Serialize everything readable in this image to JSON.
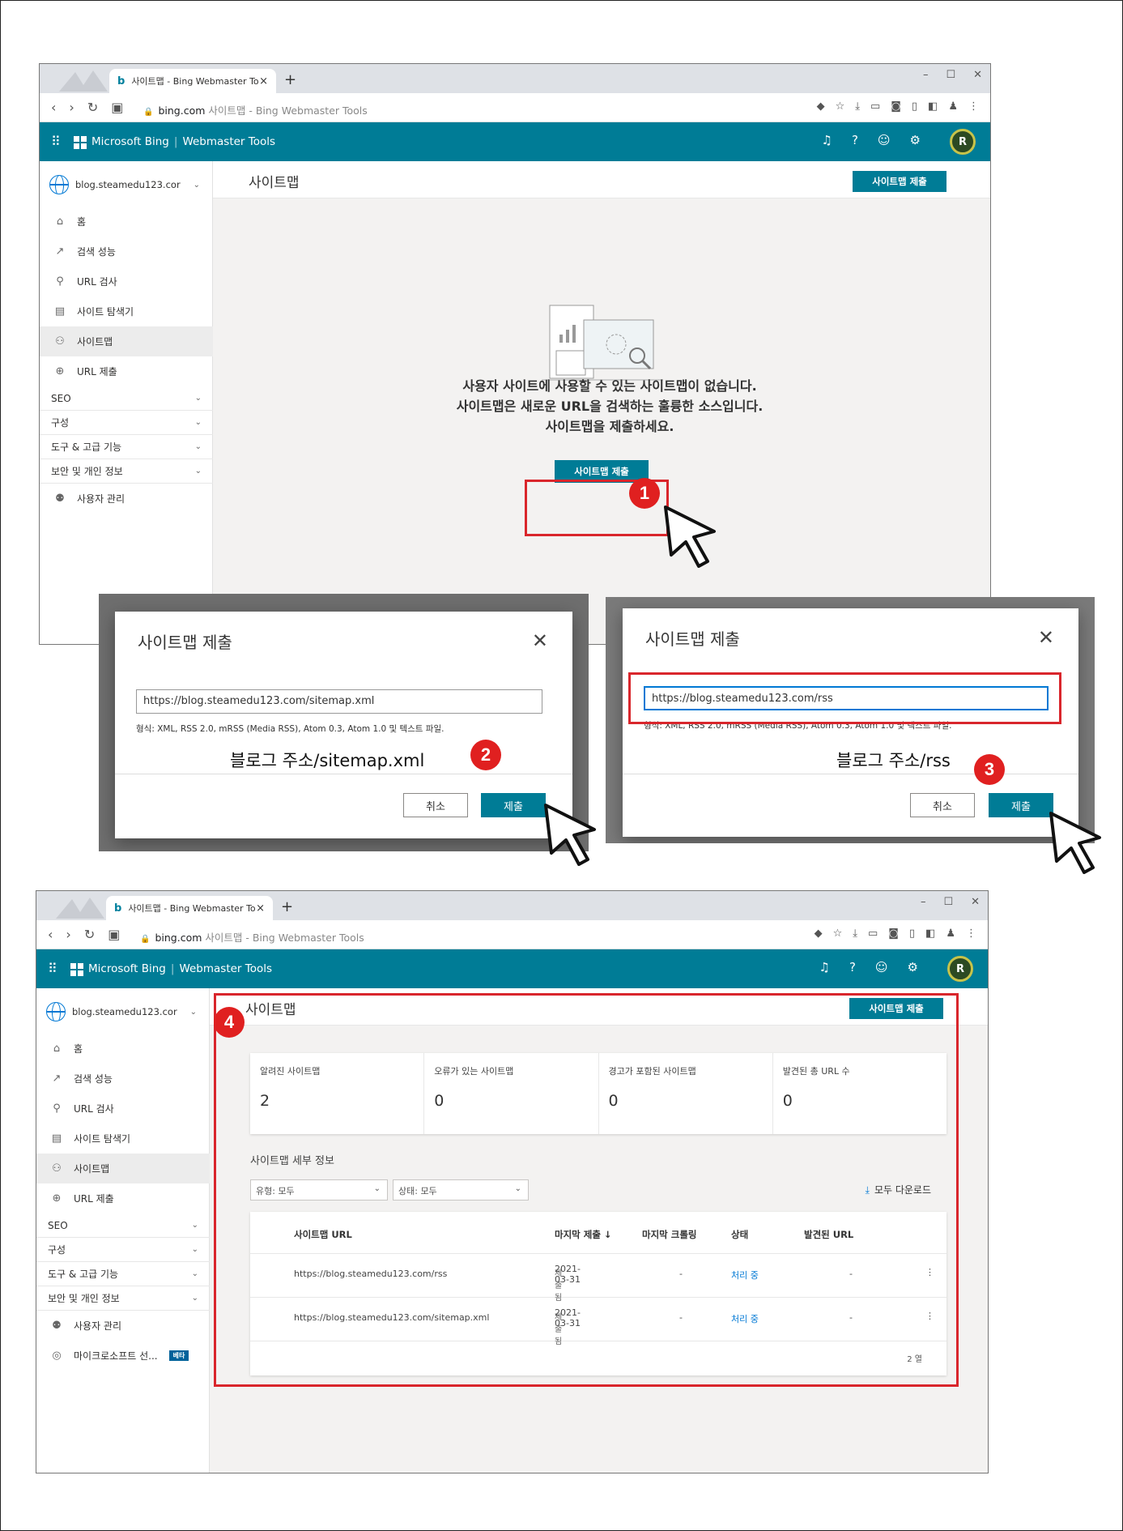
{
  "browser": {
    "tab_title": "사이트맵 - Bing Webmaster Tools",
    "url_host": "bing.com",
    "url_path": " 사이트맵 - Bing Webmaster Tools"
  },
  "header": {
    "brand": "Microsoft Bing",
    "product": "Webmaster Tools",
    "avatar": "R",
    "icons": [
      "bell-icon",
      "help-icon",
      "smiley-icon",
      "settings-icon"
    ]
  },
  "sidebar": {
    "site": "blog.steamedu123.cor",
    "items": [
      {
        "label": "홈",
        "icon": "home-icon"
      },
      {
        "label": "검색 성능",
        "icon": "trend-icon"
      },
      {
        "label": "URL 검사",
        "icon": "search-icon"
      },
      {
        "label": "사이트 탐색기",
        "icon": "document-icon"
      },
      {
        "label": "사이트맵",
        "icon": "sitemap-icon"
      },
      {
        "label": "URL 제출",
        "icon": "globe-icon"
      }
    ],
    "groups": [
      "SEO",
      "구성",
      "도구 & 고급 기능",
      "보안 및 개인 정보"
    ],
    "bottom": [
      {
        "label": "사용자 관리",
        "icon": "users-icon"
      },
      {
        "label": "마이크로소프트 선...",
        "icon": "clarity-icon"
      }
    ],
    "beta": "베타"
  },
  "page": {
    "title": "사이트맵",
    "submit_label": "사이트맵 제출",
    "empty_line1": "사용자 사이트에 사용할 수 있는 사이트맵이 없습니다.",
    "empty_line2": "사이트맵은 새로운 URL을 검색하는 훌륭한 소스입니다.",
    "empty_line3": "사이트맵을 제출하세요."
  },
  "dialog1": {
    "title": "사이트맵 제출",
    "url_value": "https://blog.steamedu123.com/sitemap.xml",
    "hint": "형식: XML, RSS 2.0, mRSS (Media RSS), Atom 0.3, Atom 1.0 및 텍스트 파일.",
    "cancel": "취소",
    "submit": "제출",
    "caption": "블로그 주소/sitemap.xml"
  },
  "dialog2": {
    "title": "사이트맵 제출",
    "url_value": "https://blog.steamedu123.com/rss",
    "hint": "형식: XML, RSS 2.0, mRSS (Media RSS), Atom 0.3, Atom 1.0 및 텍스트 파일.",
    "cancel": "취소",
    "submit": "제출",
    "caption": "블로그 주소/rss"
  },
  "steps": [
    "1",
    "2",
    "3",
    "4"
  ],
  "result": {
    "cards": [
      {
        "label": "알려진 사이트맵",
        "value": "2"
      },
      {
        "label": "오류가 있는 사이트맵",
        "value": "0"
      },
      {
        "label": "경고가 포함된 사이트맵",
        "value": "0"
      },
      {
        "label": "발견된 총 URL 수",
        "value": "0"
      }
    ],
    "details_title": "사이트맵 세부 정보",
    "filter_type": "유형: 모두",
    "filter_status": "상태: 모두",
    "download_all": "모두 다운로드",
    "columns": [
      "사이트맵 URL",
      "마지막 제출 ↓",
      "마지막 크롤링",
      "상태",
      "발견된 URL"
    ],
    "rows": [
      {
        "url": "https://blog.steamedu123.com/rss",
        "date": "2021-03-31",
        "sub": "제출됨",
        "crawl": "-",
        "status": "처리 중",
        "found": "-"
      },
      {
        "url": "https://blog.steamedu123.com/sitemap.xml",
        "date": "2021-03-31",
        "sub": "제출됨",
        "crawl": "-",
        "status": "처리 중",
        "found": "-"
      }
    ],
    "row_count": "2 열"
  },
  "colors": {
    "accent": "#007c96",
    "highlight": "#d9262c"
  }
}
